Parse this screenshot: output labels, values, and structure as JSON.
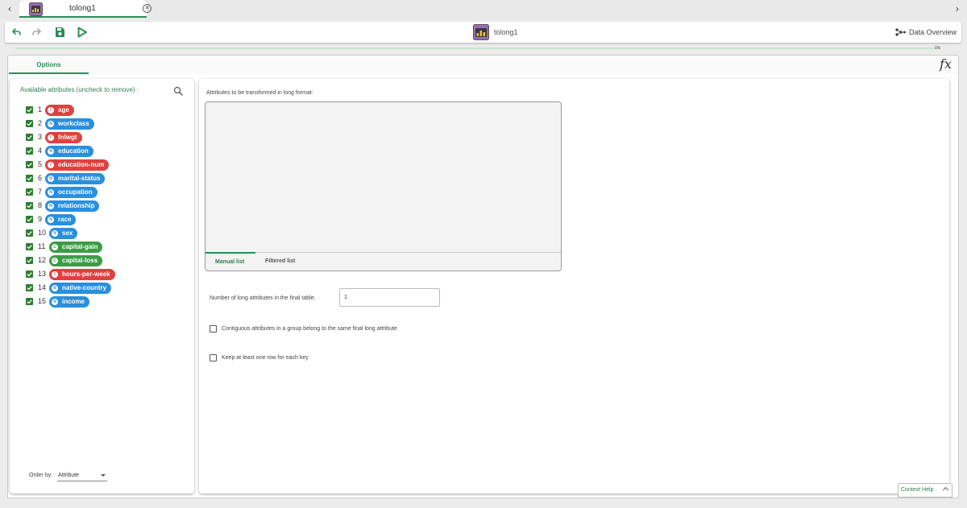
{
  "tabs": [
    {
      "label": "tolong1"
    }
  ],
  "toolbar": {
    "title": "tolong1",
    "data_overview_label": "Data Overview"
  },
  "progress": {
    "percent_label": "0%",
    "value": 0
  },
  "options_tab": {
    "label": "Options"
  },
  "fx_label": "fx",
  "left_panel": {
    "title": "Available attributes (uncheck to remove) :",
    "order_by_label": "Order by:",
    "order_by_value": "Attribute",
    "attributes": [
      {
        "num": "1",
        "name": "age",
        "type": "I",
        "checked": true
      },
      {
        "num": "2",
        "name": "workclass",
        "type": "N",
        "checked": true
      },
      {
        "num": "3",
        "name": "fnlwgt",
        "type": "I",
        "checked": true
      },
      {
        "num": "4",
        "name": "education",
        "type": "N",
        "checked": true
      },
      {
        "num": "5",
        "name": "education-num",
        "type": "I",
        "checked": true
      },
      {
        "num": "6",
        "name": "marital-status",
        "type": "N",
        "checked": true
      },
      {
        "num": "7",
        "name": "occupation",
        "type": "N",
        "checked": true
      },
      {
        "num": "8",
        "name": "relationship",
        "type": "N",
        "checked": true
      },
      {
        "num": "9",
        "name": "race",
        "type": "N",
        "checked": true
      },
      {
        "num": "10",
        "name": "sex",
        "type": "N",
        "checked": true
      },
      {
        "num": "11",
        "name": "capital-gain",
        "type": "C",
        "checked": true
      },
      {
        "num": "12",
        "name": "capital-loss",
        "type": "C",
        "checked": true
      },
      {
        "num": "13",
        "name": "hours-per-week",
        "type": "I",
        "checked": true
      },
      {
        "num": "14",
        "name": "native-country",
        "type": "N",
        "checked": true
      },
      {
        "num": "15",
        "name": "income",
        "type": "N",
        "checked": true
      }
    ]
  },
  "right_panel": {
    "long_label": "Attributes to be transformed in long format:",
    "manual_list_tab": "Manual list",
    "filtered_list_tab": "Filtered list",
    "num_long_label": "Number of long attributes in the final table:",
    "num_long_value": "1",
    "contiguous_label": "Contiguous attributes in a group belong to the same final long attribute",
    "contiguous_checked": false,
    "keep_row_label": "Keep at least one row for each key",
    "keep_row_checked": false
  },
  "context_help": {
    "label": "Context Help"
  },
  "colors": {
    "accent": "#2e8b57",
    "integer": "#e04040",
    "nominal": "#2a8fdc",
    "continuous": "#3a9d45"
  }
}
